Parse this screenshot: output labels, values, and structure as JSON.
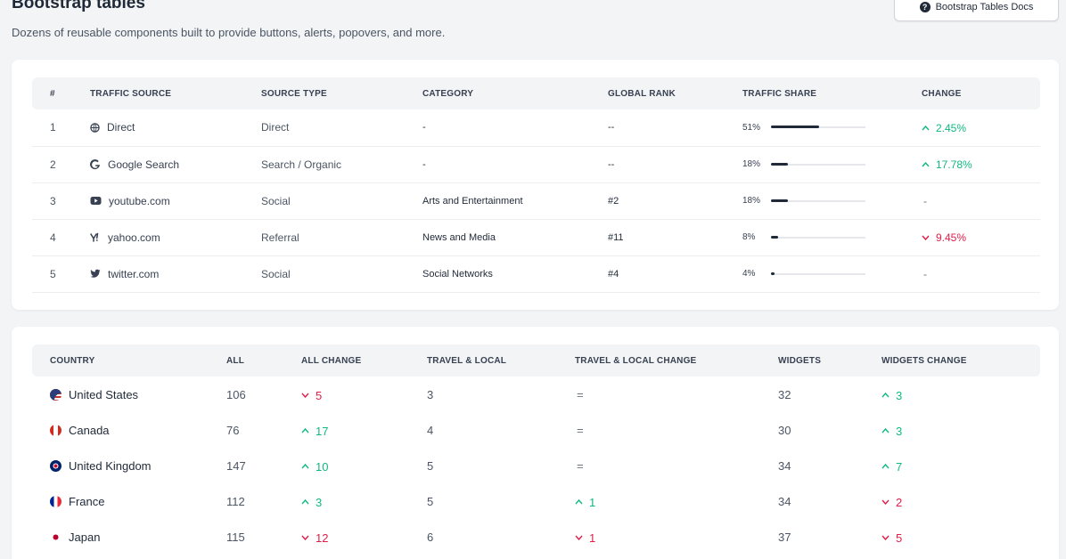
{
  "header": {
    "title": "Bootstrap tables",
    "subtitle": "Dozens of reusable components built to provide buttons, alerts, popovers, and more.",
    "docs_button": "Bootstrap Tables Docs"
  },
  "traffic_table": {
    "columns": [
      "#",
      "Traffic Source",
      "Source Type",
      "Category",
      "Global Rank",
      "Traffic Share",
      "Change"
    ],
    "rows": [
      {
        "num": "1",
        "source": "Direct",
        "icon": "globe-icon",
        "type": "Direct",
        "category": "-",
        "rank": "--",
        "share": "51%",
        "share_value": 0.51,
        "change": "2.45%",
        "dir": "up"
      },
      {
        "num": "2",
        "source": "Google Search",
        "icon": "google-icon",
        "type": "Search / Organic",
        "category": "-",
        "rank": "--",
        "share": "18%",
        "share_value": 0.18,
        "change": "17.78%",
        "dir": "up"
      },
      {
        "num": "3",
        "source": "youtube.com",
        "icon": "youtube-icon",
        "type": "Social",
        "category": "Arts and Entertainment",
        "rank": "#2",
        "share": "18%",
        "share_value": 0.18,
        "change": "-",
        "dir": "none"
      },
      {
        "num": "4",
        "source": "yahoo.com",
        "icon": "yahoo-icon",
        "type": "Referral",
        "category": "News and Media",
        "rank": "#11",
        "share": "8%",
        "share_value": 0.08,
        "change": "9.45%",
        "dir": "down"
      },
      {
        "num": "5",
        "source": "twitter.com",
        "icon": "twitter-icon",
        "type": "Social",
        "category": "Social Networks",
        "rank": "#4",
        "share": "4%",
        "share_value": 0.04,
        "change": "-",
        "dir": "none"
      }
    ]
  },
  "country_table": {
    "columns": [
      "Country",
      "All",
      "All Change",
      "Travel & Local",
      "Travel & Local Change",
      "Widgets",
      "Widgets Change"
    ],
    "rows": [
      {
        "country": "United States",
        "flag": "us-flag-icon",
        "all": "106",
        "all_change": "5",
        "all_dir": "down",
        "travel": "3",
        "travel_change": "=",
        "travel_dir": "none",
        "widgets": "32",
        "widgets_change": "3",
        "widgets_dir": "up"
      },
      {
        "country": "Canada",
        "flag": "ca-flag-icon",
        "all": "76",
        "all_change": "17",
        "all_dir": "up",
        "travel": "4",
        "travel_change": "=",
        "travel_dir": "none",
        "widgets": "30",
        "widgets_change": "3",
        "widgets_dir": "up"
      },
      {
        "country": "United Kingdom",
        "flag": "uk-flag-icon",
        "all": "147",
        "all_change": "10",
        "all_dir": "up",
        "travel": "5",
        "travel_change": "=",
        "travel_dir": "none",
        "widgets": "34",
        "widgets_change": "7",
        "widgets_dir": "up"
      },
      {
        "country": "France",
        "flag": "fr-flag-icon",
        "all": "112",
        "all_change": "3",
        "all_dir": "up",
        "travel": "5",
        "travel_change": "1",
        "travel_dir": "up",
        "widgets": "34",
        "widgets_change": "2",
        "widgets_dir": "down"
      },
      {
        "country": "Japan",
        "flag": "jp-flag-icon",
        "all": "115",
        "all_change": "12",
        "all_dir": "down",
        "travel": "6",
        "travel_change": "1",
        "travel_dir": "down",
        "widgets": "37",
        "widgets_change": "5",
        "widgets_dir": "down"
      }
    ]
  },
  "colors": {
    "up": "#10b981",
    "down": "#e11d48",
    "bar": "#1f2937",
    "header_bg": "#f3f4f6"
  }
}
